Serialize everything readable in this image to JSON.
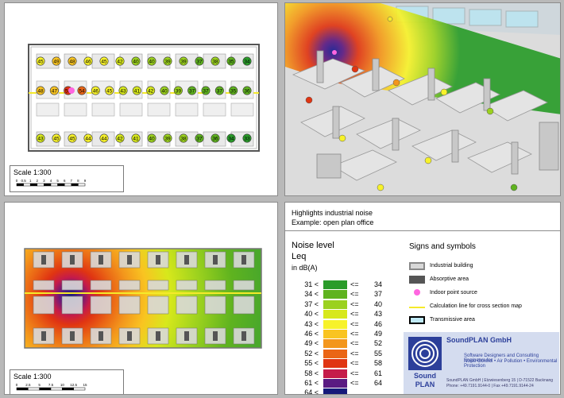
{
  "top_left": {
    "scale_label": "Scale 1:300",
    "scale_ticks": [
      "0",
      "0.5",
      "1",
      "2",
      "3",
      "4",
      "5",
      "6",
      "7",
      "8",
      "9"
    ],
    "receivers_top_row": [
      "45",
      "49",
      "48",
      "46",
      "45",
      "42",
      "40",
      "40",
      "39",
      "39",
      "37",
      "38",
      "35",
      "34"
    ],
    "receivers_mid_row": [
      "48",
      "47",
      "58",
      "54",
      "46",
      "45",
      "43",
      "41",
      "42",
      "40",
      "39",
      "37",
      "37",
      "37",
      "35",
      "36"
    ],
    "receivers_bottom_row": [
      "43",
      "45",
      "45",
      "44",
      "44",
      "42",
      "41",
      "40",
      "39",
      "38",
      "37",
      "36",
      "34",
      "33"
    ]
  },
  "bottom_left": {
    "scale_label": "Scale 1:300",
    "scale_ticks": [
      "0",
      "2.5",
      "5",
      "7.5",
      "10",
      "12.5",
      "15"
    ]
  },
  "info": {
    "heading_line1": "Highlights industrial noise",
    "heading_line2": "Example: open plan office",
    "noise_level_title": "Noise level",
    "noise_level_leq": "Leq",
    "noise_level_unit": "in dB(A)",
    "legend": [
      {
        "low": "31 <",
        "sep": "<=",
        "high": "34",
        "color": "#2a9c2a"
      },
      {
        "low": "34 <",
        "sep": "<=",
        "high": "37",
        "color": "#5fb31f"
      },
      {
        "low": "37 <",
        "sep": "<=",
        "high": "40",
        "color": "#9bd11e"
      },
      {
        "low": "40 <",
        "sep": "<=",
        "high": "43",
        "color": "#d7e81c"
      },
      {
        "low": "43 <",
        "sep": "<=",
        "high": "46",
        "color": "#f7f22a"
      },
      {
        "low": "46 <",
        "sep": "<=",
        "high": "49",
        "color": "#f9c421"
      },
      {
        "low": "49 <",
        "sep": "<=",
        "high": "52",
        "color": "#f3961c"
      },
      {
        "low": "52 <",
        "sep": "<=",
        "high": "55",
        "color": "#ea6515"
      },
      {
        "low": "55 <",
        "sep": "<=",
        "high": "58",
        "color": "#e03512"
      },
      {
        "low": "58 <",
        "sep": "<=",
        "high": "61",
        "color": "#c51b4a"
      },
      {
        "low": "61 <",
        "sep": "<=",
        "high": "64",
        "color": "#5a1a82"
      },
      {
        "low": "64 <",
        "sep": "",
        "high": "",
        "color": "#161a7a"
      }
    ],
    "signs_title": "Signs and symbols",
    "signs": [
      {
        "label": "Industrial building",
        "icon": "industrial-building-swatch"
      },
      {
        "label": "Absorptive area",
        "icon": "absorptive-area-swatch"
      },
      {
        "label": "Indoor point source",
        "icon": "point-source-dot"
      },
      {
        "label": "Calculation line for cross section map",
        "icon": "calculation-line"
      },
      {
        "label": "Transmissive area",
        "icon": "transmissive-area-swatch"
      }
    ],
    "logo": {
      "company": "SoundPLAN GmbH",
      "line1": "Software Designers and Consulting Engineers for",
      "line2": "Noise Control • Air Pollution • Environmental Protection",
      "address": "SoundPLAN GmbH | Etzwiesenberg 15 | D-71522 Backnang",
      "phone": "Phone: +49.7191.9144-0 | Fax +49.7191.9144-24"
    }
  },
  "colors": {
    "industrial_building": "#d8d8d8",
    "absorptive_area": "#555555",
    "point_source": "#ff66e0",
    "calculation_line": "#f5ea2a",
    "logo_blue": "#2c3f9a"
  }
}
